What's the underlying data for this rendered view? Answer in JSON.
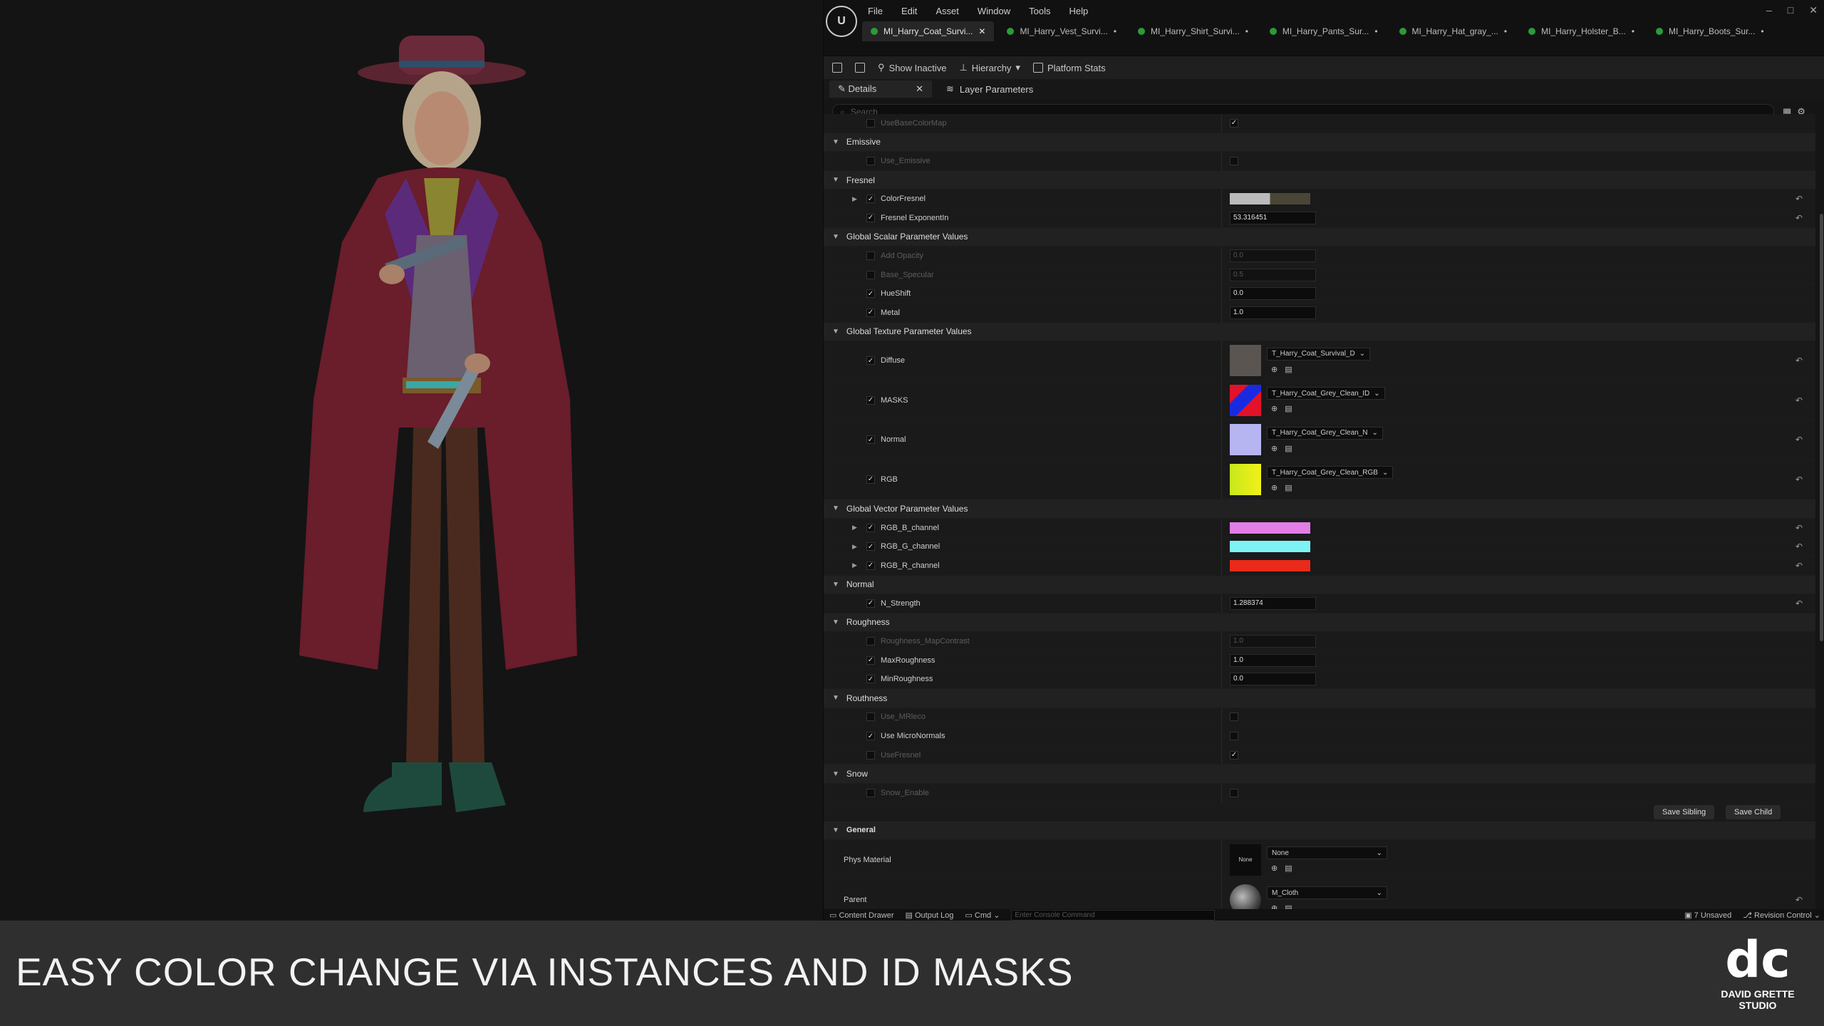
{
  "menu": [
    "File",
    "Edit",
    "Asset",
    "Window",
    "Tools",
    "Help"
  ],
  "tabs": [
    {
      "label": "MI_Harry_Coat_Survi...",
      "active": true
    },
    {
      "label": "MI_Harry_Vest_Survi..."
    },
    {
      "label": "MI_Harry_Shirt_Survi..."
    },
    {
      "label": "MI_Harry_Pants_Sur..."
    },
    {
      "label": "MI_Harry_Hat_gray_..."
    },
    {
      "label": "MI_Harry_Holster_B..."
    },
    {
      "label": "MI_Harry_Boots_Sur..."
    }
  ],
  "toolbar": {
    "show_inactive": "Show Inactive",
    "hierarchy": "Hierarchy",
    "platform_stats": "Platform Stats"
  },
  "panel_tabs": {
    "details": "Details",
    "layer_params": "Layer Parameters"
  },
  "search": {
    "placeholder": "Search"
  },
  "rows": {
    "usebasecolormap": "UseBaseColorMap",
    "emissive": "Emissive",
    "use_emissive": "Use_Emissive",
    "fresnel": "Fresnel",
    "colorfresnel": "ColorFresnel",
    "fresnel_exp": "Fresnel ExponentIn",
    "fresnel_exp_val": "53.316451",
    "global_scalar": "Global Scalar Parameter Values",
    "add_opacity": "Add Opacity",
    "add_opacity_val": "0.0",
    "base_specular": "Base_Specular",
    "base_specular_val": "0.5",
    "hueshift": "HueShift",
    "hueshift_val": "0.0",
    "metal": "Metal",
    "metal_val": "1.0",
    "global_texture": "Global Texture Parameter Values",
    "diffuse": "Diffuse",
    "diffuse_tex": "T_Harry_Coat_Survival_D",
    "masks": "MASKS",
    "masks_tex": "T_Harry_Coat_Grey_Clean_ID",
    "normal": "Normal",
    "normal_tex": "T_Harry_Coat_Grey_Clean_N",
    "rgb": "RGB",
    "rgb_tex": "T_Harry_Coat_Grey_Clean_RGB",
    "global_vector": "Global Vector Parameter Values",
    "rgb_b": "RGB_B_channel",
    "rgb_g": "RGB_G_channel",
    "rgb_r": "RGB_R_channel",
    "normal_cat": "Normal",
    "n_strength": "N_Strength",
    "n_strength_val": "1.288374",
    "roughness": "Roughness",
    "roughness_mapcontrast": "Roughness_MapContrast",
    "roughness_mapcontrast_val": "1.0",
    "maxroughness": "MaxRoughness",
    "maxroughness_val": "1.0",
    "minroughness": "MinRoughness",
    "minroughness_val": "0.0",
    "routhness": "Routhness",
    "use_mrleco": "Use_MRleco",
    "use_micronormals": "Use MicroNormals",
    "usefresnel": "UseFresnel",
    "snow": "Snow",
    "snow_enable": "Snow_Enable",
    "general": "General",
    "phys_material": "Phys Material",
    "phys_none": "None",
    "phys_thumb": "None",
    "parent": "Parent",
    "parent_val": "M_Cloth"
  },
  "buttons": {
    "save_sibling": "Save Sibling",
    "save_child": "Save Child"
  },
  "statusbar": {
    "content_drawer": "Content Drawer",
    "output_log": "Output Log",
    "cmd": "Cmd",
    "cmd_placeholder": "Enter Console Command",
    "unsaved": "7 Unsaved",
    "revision": "Revision Control"
  },
  "colors": {
    "rgb_b": "#e27ee6",
    "rgb_g": "#7df3f4",
    "rgb_r": "#ea2a1b",
    "fresnel": "#4a4636"
  },
  "banner": {
    "title": "EASY COLOR CHANGE VIA INSTANCES AND ID MASKS",
    "studio_line1": "DAVID GRETTE",
    "studio_line2": "STUDIO"
  }
}
